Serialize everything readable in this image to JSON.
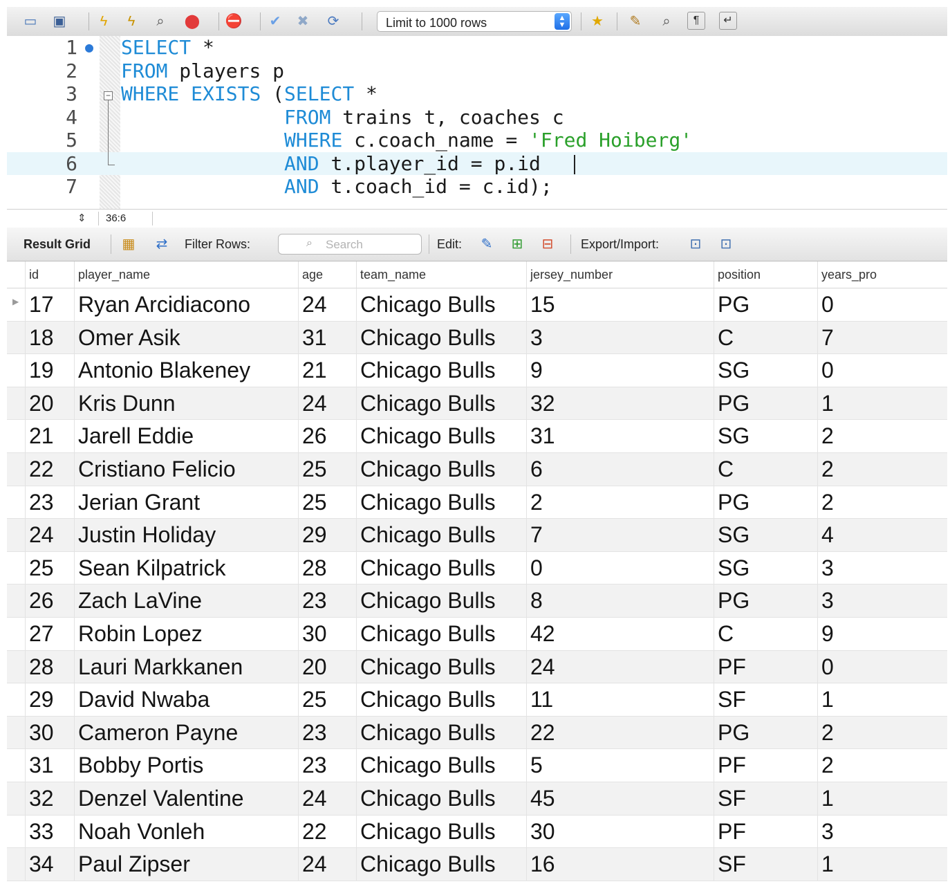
{
  "toolbar": {
    "icons": [
      "open-folder-icon",
      "save-icon",
      "execute-lightning-icon",
      "execute-cursor-lightning-icon",
      "explain-magnifier-icon",
      "stop-icon",
      "toggle-error-stop-icon",
      "commit-check-icon",
      "rollback-x-icon",
      "autocommit-icon",
      "bookmark-star-icon",
      "beautify-broom-icon",
      "find-magnifier-icon",
      "invisible-chars-icon",
      "wrap-lines-icon"
    ],
    "limit_label": "Limit to 1000 rows"
  },
  "editor": {
    "line_numbers": [
      "1",
      "2",
      "3",
      "4",
      "5",
      "6",
      "7"
    ],
    "cursor_line": 6
  },
  "status": {
    "position": "36:6"
  },
  "result": {
    "result_grid_label": "Result Grid",
    "filter_rows_label": "Filter Rows:",
    "search_placeholder": "Search",
    "edit_label": "Edit:",
    "export_label": "Export/Import:"
  },
  "grid": {
    "columns": [
      "id",
      "player_name",
      "age",
      "team_name",
      "jersey_number",
      "position",
      "years_pro"
    ],
    "rows": [
      [
        "17",
        "Ryan Arcidiacono",
        "24",
        "Chicago Bulls",
        "15",
        "PG",
        "0"
      ],
      [
        "18",
        "Omer Asik",
        "31",
        "Chicago Bulls",
        "3",
        "C",
        "7"
      ],
      [
        "19",
        "Antonio Blakeney",
        "21",
        "Chicago Bulls",
        "9",
        "SG",
        "0"
      ],
      [
        "20",
        "Kris Dunn",
        "24",
        "Chicago Bulls",
        "32",
        "PG",
        "1"
      ],
      [
        "21",
        "Jarell Eddie",
        "26",
        "Chicago Bulls",
        "31",
        "SG",
        "2"
      ],
      [
        "22",
        "Cristiano Felicio",
        "25",
        "Chicago Bulls",
        "6",
        "C",
        "2"
      ],
      [
        "23",
        "Jerian Grant",
        "25",
        "Chicago Bulls",
        "2",
        "PG",
        "2"
      ],
      [
        "24",
        "Justin Holiday",
        "29",
        "Chicago Bulls",
        "7",
        "SG",
        "4"
      ],
      [
        "25",
        "Sean Kilpatrick",
        "28",
        "Chicago Bulls",
        "0",
        "SG",
        "3"
      ],
      [
        "26",
        "Zach LaVine",
        "23",
        "Chicago Bulls",
        "8",
        "PG",
        "3"
      ],
      [
        "27",
        "Robin Lopez",
        "30",
        "Chicago Bulls",
        "42",
        "C",
        "9"
      ],
      [
        "28",
        "Lauri Markkanen",
        "20",
        "Chicago Bulls",
        "24",
        "PF",
        "0"
      ],
      [
        "29",
        "David Nwaba",
        "25",
        "Chicago Bulls",
        "11",
        "SF",
        "1"
      ],
      [
        "30",
        "Cameron Payne",
        "23",
        "Chicago Bulls",
        "22",
        "PG",
        "2"
      ],
      [
        "31",
        "Bobby Portis",
        "23",
        "Chicago Bulls",
        "5",
        "PF",
        "2"
      ],
      [
        "32",
        "Denzel Valentine",
        "24",
        "Chicago Bulls",
        "45",
        "SF",
        "1"
      ],
      [
        "33",
        "Noah Vonleh",
        "22",
        "Chicago Bulls",
        "30",
        "PF",
        "3"
      ],
      [
        "34",
        "Paul Zipser",
        "24",
        "Chicago Bulls",
        "16",
        "SF",
        "1"
      ]
    ]
  }
}
